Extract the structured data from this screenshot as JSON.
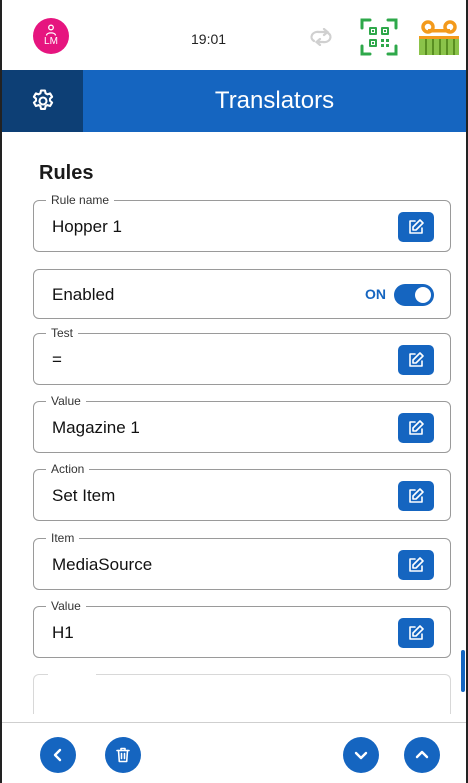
{
  "status_bar": {
    "avatar_initials": "LM",
    "time": "19:01",
    "icons": [
      "user-icon",
      "sync-icon",
      "qr-code-icon",
      "cassette-icon"
    ],
    "avatar_color": "#e6157f"
  },
  "header": {
    "title": "Translators",
    "settings_icon": "gear-icon",
    "color": "#1565c0",
    "settings_bg": "#0d3f75"
  },
  "main": {
    "section_title": "Rules",
    "fields": [
      {
        "label": "Rule name",
        "value": "Hopper 1"
      },
      {
        "label": "Test",
        "value": "="
      },
      {
        "label": "Value",
        "value": "Magazine 1"
      },
      {
        "label": "Action",
        "value": "Set Item"
      },
      {
        "label": "Item",
        "value": "MediaSource"
      },
      {
        "label": "Value",
        "value": "H1"
      }
    ],
    "enabled": {
      "label": "Enabled",
      "state": "ON",
      "on": true
    }
  },
  "footer": {
    "buttons": [
      "chevron-left-icon",
      "trash-icon",
      "chevron-down-icon",
      "chevron-up-icon"
    ]
  }
}
